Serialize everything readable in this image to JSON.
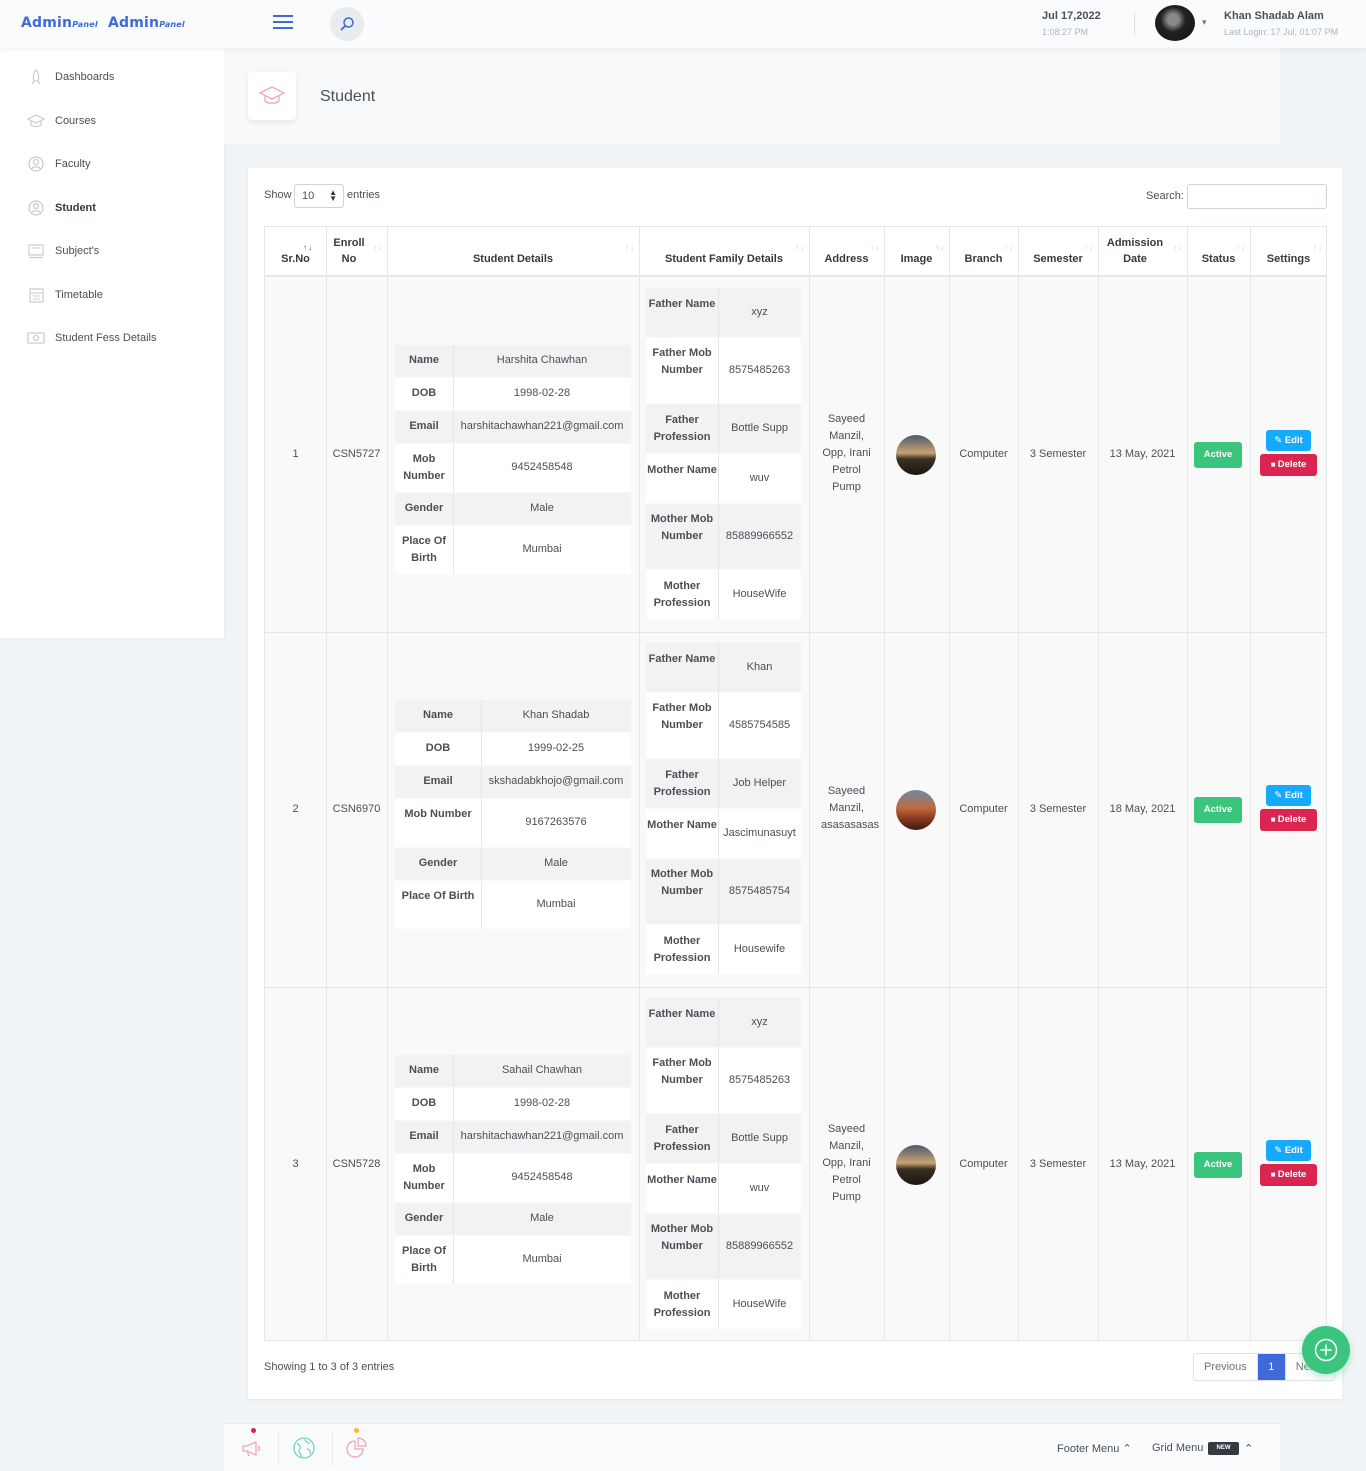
{
  "header": {
    "logo_text": "Admin",
    "logo_small": "Panel",
    "date": "Jul 17,2022",
    "time": "1:08:27 PM",
    "user_name": "Khan Shadab Alam",
    "last_login": "Last Login: 17 Jul, 01:07 PM"
  },
  "sidebar": {
    "items": [
      {
        "label": "Dashboards",
        "icon": "rocket-icon"
      },
      {
        "label": "Courses",
        "icon": "graduation-cap-icon"
      },
      {
        "label": "Faculty",
        "icon": "user-circle-icon"
      },
      {
        "label": "Student",
        "icon": "user-circle-icon",
        "active": true
      },
      {
        "label": "Subject's",
        "icon": "board-icon"
      },
      {
        "label": "Timetable",
        "icon": "calendar-icon"
      },
      {
        "label": "Student Fess Details",
        "icon": "money-icon"
      }
    ]
  },
  "page": {
    "title": "Student"
  },
  "table_controls": {
    "show_label": "Show",
    "page_length": "10",
    "entries_label": "entries",
    "search_label": "Search:"
  },
  "columns": [
    "Sr.No",
    "Enroll No",
    "Student Details",
    "Student Family Details",
    "Address",
    "Image",
    "Branch",
    "Semester",
    "Admission Date",
    "Status",
    "Settings"
  ],
  "student_keys": [
    "Name",
    "DOB",
    "Email",
    "Mob Number",
    "Gender",
    "Place Of Birth"
  ],
  "family_keys": [
    "Father Name",
    "Father Mob Number",
    "Father Profession",
    "Mother Name",
    "Mother Mob Number",
    "Mother Profession"
  ],
  "rows": [
    {
      "sr": "1",
      "enroll": "CSN5727",
      "student": [
        "Harshita Chawhan",
        "1998-02-28",
        "harshitachawhan221@gmail.com",
        "9452458548",
        "Male",
        "Mumbai"
      ],
      "family": [
        "xyz",
        "8575485263",
        "Bottle Supp",
        "wuv",
        "85889966552",
        "HouseWife"
      ],
      "address": "Sayeed Manzil, Opp, Irani Petrol Pump",
      "branch": "Computer",
      "semester": "3 Semester",
      "admission": "13 May, 2021",
      "status": "Active",
      "edit": "Edit",
      "delete": "Delete"
    },
    {
      "sr": "2",
      "enroll": "CSN6970",
      "student": [
        "Khan Shadab",
        "1999-02-25",
        "skshadabkhojo@gmail.com",
        "9167263576",
        "Male",
        "Mumbai"
      ],
      "family": [
        "Khan",
        "4585754585",
        "Job Helper",
        "Jascimunasuyt",
        "8575485754",
        "Housewife"
      ],
      "address": "Sayeed Manzil, asasasasas",
      "branch": "Computer",
      "semester": "3 Semester",
      "admission": "18 May, 2021",
      "status": "Active",
      "edit": "Edit",
      "delete": "Delete"
    },
    {
      "sr": "3",
      "enroll": "CSN5728",
      "student": [
        "Sahail Chawhan",
        "1998-02-28",
        "harshitachawhan221@gmail.com",
        "9452458548",
        "Male",
        "Mumbai"
      ],
      "family": [
        "xyz",
        "8575485263",
        "Bottle Supp",
        "wuv",
        "85889966552",
        "HouseWife"
      ],
      "address": "Sayeed Manzil, Opp, Irani Petrol Pump",
      "branch": "Computer",
      "semester": "3 Semester",
      "admission": "13 May, 2021",
      "status": "Active",
      "edit": "Edit",
      "delete": "Delete"
    }
  ],
  "pagination": {
    "info": "Showing 1 to 3 of 3 entries",
    "previous": "Previous",
    "current": "1",
    "next": "Next"
  },
  "footer": {
    "footer_menu": "Footer Menu",
    "grid_menu": "Grid Menu",
    "new_badge": "NEW"
  },
  "colors": {
    "primary": "#3f6ad8",
    "success": "#3ac47d",
    "info": "#16aaff",
    "danger": "#d92550"
  }
}
